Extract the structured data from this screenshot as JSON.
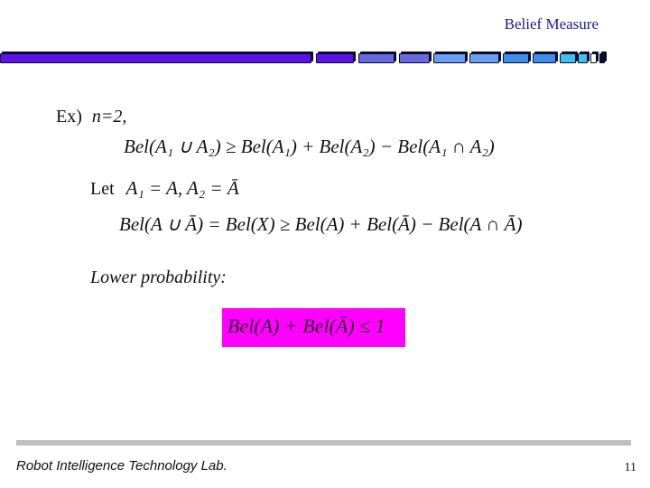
{
  "header": {
    "title": "Belief Measure",
    "bar_colors": [
      "#5b12e6",
      "#5b12e6",
      "#6a6ae0",
      "#6a6ae0",
      "#6a9ef0",
      "#6a9ef0",
      "#3f8fe8",
      "#3f8fe8",
      "#40c0f0",
      "#40c0f0",
      "#ffffff",
      "#0a0a2a"
    ]
  },
  "content": {
    "example_label": "Ex)",
    "example_n": "n=2,",
    "eq1": {
      "lhs": "Bel(A₁ ∪ A₂)",
      "rel": "≥",
      "rhs": "Bel(A₁) + Bel(A₂) − Bel(A₁ ∩ A₂)"
    },
    "let_label": "Let",
    "let_expr": "A₁ = A,  A₂ = Ā",
    "eq2": {
      "lhs": "Bel(A ∪ Ā)",
      "mid": "= Bel(X)",
      "rel": "≥",
      "rhs": "Bel(A) + Bel(Ā) − Bel(A ∩ Ā)"
    },
    "lower_prob_label": "Lower probability:",
    "highlight_eq": "Bel(A) + Bel(Ā) ≤ 1",
    "highlight_color": "#ff00ff"
  },
  "footer": {
    "lab_name": "Robot Intelligence Technology Lab.",
    "page_number": "11"
  }
}
